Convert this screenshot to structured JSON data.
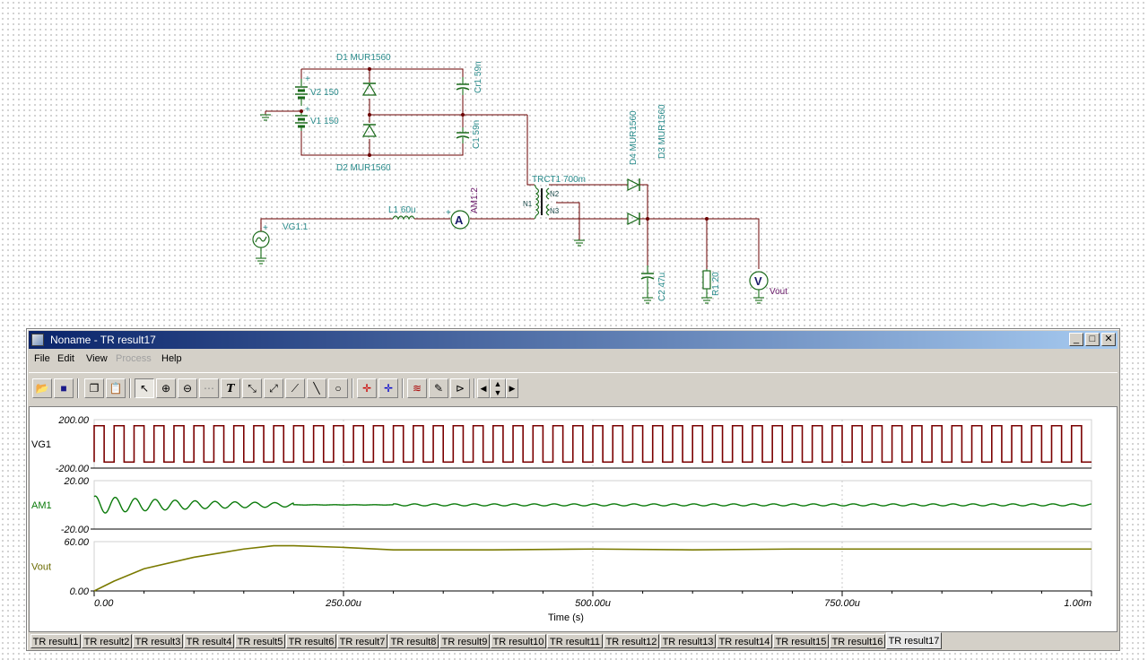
{
  "schematic": {
    "labels": {
      "D1": "D1 MUR1560",
      "D2": "D2 MUR1560",
      "V2": "V2 150",
      "V1": "V1 150",
      "Cr1": "Cr1 59n",
      "C1": "C1 59n",
      "TRCT1": "TRCT1 700m",
      "D4": "D4 MUR1560",
      "D3": "D3 MUR1560",
      "L1": "L1 60u",
      "AM1": "AM1:2",
      "VG1": "VG1:1",
      "N1": "N1",
      "N2": "N2",
      "N3": "N3",
      "C2": "C2 47u",
      "R1": "R1 20",
      "Vout": "Vout",
      "plus_v2": "+",
      "plus_v1": "+",
      "plus_vg": "+",
      "plus_am": "+"
    }
  },
  "window": {
    "title": "Noname - TR result17",
    "controls": {
      "minimize": "_",
      "maximize": "□",
      "close": "✕"
    }
  },
  "menu": {
    "items": [
      "File",
      "Edit",
      "View",
      "Process",
      "Help"
    ]
  },
  "toolbar": {
    "buttons": [
      "open-icon",
      "save-icon",
      "copy-icon",
      "paste-icon",
      "pointer-icon",
      "zoom-in-icon",
      "zoom-out-icon",
      "grid-icon",
      "text-icon",
      "cursor-a-icon",
      "cursor-b-icon",
      "cursor-c-icon",
      "line-icon",
      "circle-icon",
      "marker-a-icon",
      "marker-b-icon",
      "wave-icon",
      "probe-icon",
      "flag-icon",
      "scroll-left-icon",
      "scroll-vertical-icon",
      "scroll-right-icon"
    ],
    "text_button": "T"
  },
  "chart_data": {
    "type": "line",
    "xlabel": "Time (s)",
    "x_ticks": [
      "0.00",
      "250.00u",
      "500.00u",
      "750.00u",
      "1.00m"
    ],
    "xlim": [
      0,
      0.001
    ],
    "panels": [
      {
        "name": "VG1",
        "ylim": [
          -200,
          200
        ],
        "y_ticks": [
          "200.00",
          "-200.00"
        ],
        "color": "#7a0000",
        "description": "square wave",
        "high": 150,
        "low": -150,
        "frequency_hz": 50000
      },
      {
        "name": "AM1",
        "ylim": [
          -20,
          20
        ],
        "y_ticks": [
          "20.00",
          "-20.00"
        ],
        "color": "#0a7a0a",
        "description": "damped oscillation settling at ~0",
        "initial_amplitude": 7,
        "steady_amplitude": 0.8,
        "oscillation_hz": 50000
      },
      {
        "name": "Vout",
        "ylim": [
          0,
          60
        ],
        "y_ticks": [
          "60.00",
          "0.00"
        ],
        "color": "#7a7a00",
        "points": [
          [
            0,
            0
          ],
          [
            2e-05,
            12
          ],
          [
            5e-05,
            27
          ],
          [
            0.0001,
            41
          ],
          [
            0.00015,
            51
          ],
          [
            0.00018,
            55
          ],
          [
            0.0002,
            55
          ],
          [
            0.00025,
            53
          ],
          [
            0.0003,
            50
          ],
          [
            0.0004,
            50
          ],
          [
            0.0005,
            51
          ],
          [
            0.0006,
            50
          ],
          [
            0.0007,
            51
          ],
          [
            0.0008,
            51
          ],
          [
            0.0009,
            51
          ],
          [
            0.001,
            51
          ]
        ]
      }
    ]
  },
  "tabs": {
    "items": [
      "TR result1",
      "TR result2",
      "TR result3",
      "TR result4",
      "TR result5",
      "TR result6",
      "TR result7",
      "TR result8",
      "TR result9",
      "TR result10",
      "TR result11",
      "TR result12",
      "TR result13",
      "TR result14",
      "TR result15",
      "TR result16",
      "TR result17"
    ],
    "active": 16
  }
}
